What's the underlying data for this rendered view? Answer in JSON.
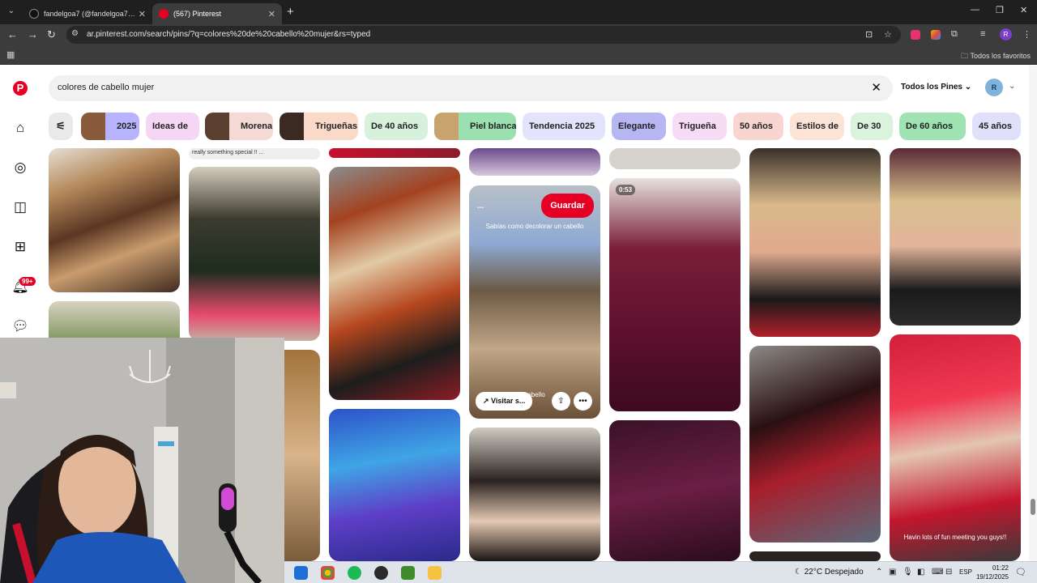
{
  "browser": {
    "tabs": [
      {
        "title": "fandelgoa7 (@fandelgoa7_) | TikTok",
        "active": false,
        "icon_color": "#111111"
      },
      {
        "title": "(567) Pinterest",
        "active": true,
        "icon_color": "#e60023"
      }
    ],
    "url": "ar.pinterest.com/search/pins/?q=colores%20de%20cabello%20mujer&rs=typed",
    "all_bookmarks_label": "Todos los favoritos",
    "profile_initial": "R"
  },
  "pinterest": {
    "search_query": "colores de cabello mujer",
    "filter_label": "Todos los Pines",
    "avatar_initial": "R",
    "notifications_count": "99+",
    "chips": [
      {
        "label": "2025",
        "bg": "#b8b3ff",
        "thumb": "#8a5a3c"
      },
      {
        "label": "Ideas de",
        "bg": "#f6d6f5",
        "thumb": ""
      },
      {
        "label": "Morena",
        "bg": "#f4d9d4",
        "thumb": "#5a3e2e"
      },
      {
        "label": "Trigueñas",
        "bg": "#fbd9c9",
        "thumb": "#3a2a22"
      },
      {
        "label": "De 40 años",
        "bg": "#d7f1dd",
        "thumb": ""
      },
      {
        "label": "Piel blanca",
        "bg": "#9be0b0",
        "thumb": "#c9a36e"
      },
      {
        "label": "Tendencia 2025",
        "bg": "#e3e3fb",
        "thumb": ""
      },
      {
        "label": "Elegante",
        "bg": "#b6b6f2",
        "thumb": ""
      },
      {
        "label": "Trigueña",
        "bg": "#f7dcf5",
        "thumb": ""
      },
      {
        "label": "50 años",
        "bg": "#f8d5d1",
        "thumb": ""
      },
      {
        "label": "Estilos de",
        "bg": "#fbe3d6",
        "thumb": ""
      },
      {
        "label": "De 30",
        "bg": "#d9f3dd",
        "thumb": ""
      },
      {
        "label": "De 60 años",
        "bg": "#9fe3b3",
        "thumb": ""
      },
      {
        "label": "45 años",
        "bg": "#e0e0fb",
        "thumb": ""
      }
    ],
    "pin_texts": {
      "caption_top": "really something special !! ...",
      "video_duration": "0:53",
      "save_label": "Guardar",
      "more_label": "...",
      "overlay_caption": "Sabías como decolorar un cabello",
      "visit_label": "Visitar s...",
      "visit_caption": "cabello",
      "fan_caption": "Havin lots of fun meeting you guys!!"
    }
  },
  "taskbar": {
    "weather": "22°C  Despejado",
    "lang": "ESP",
    "time": "01:22",
    "date": "19/12/2025"
  },
  "colors": {
    "pinterest_red": "#e60023",
    "chrome_dark": "#3c3c3c"
  }
}
